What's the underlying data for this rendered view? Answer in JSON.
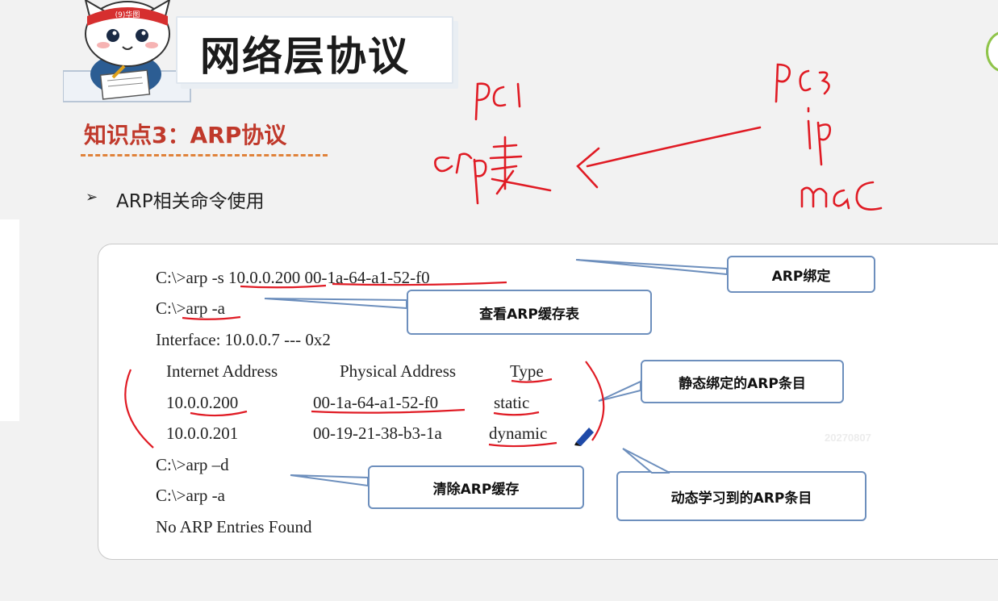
{
  "header": {
    "mascot_badge": "(9)华图",
    "title": "网络层协议",
    "subtitle": "知识点3：ARP协议",
    "bullet_glyph": "➢",
    "bullet_text": "ARP相关命令使用"
  },
  "handwriting": {
    "pc1": "PC1",
    "arp_table": "arp表",
    "pc3": "PC3",
    "ip": "ip",
    "mac": "mac"
  },
  "code_lines": {
    "l1": "C:\\>arp -s 10.0.0.200 00-1a-64-a1-52-f0",
    "l2": "C:\\>arp -a",
    "l3": "Interface: 10.0.0.7 --- 0x2",
    "h_ip": "Internet Address",
    "h_mac": "Physical Address",
    "h_type": "Type",
    "r1_ip": "10.0.0.200",
    "r1_mac": "00-1a-64-a1-52-f0",
    "r1_type": "static",
    "r2_ip": "10.0.0.201",
    "r2_mac": "00-19-21-38-b3-1a",
    "r2_type": "dynamic",
    "l7": "C:\\>arp –d",
    "l8": "C:\\>arp -a",
    "l9": "No ARP Entries Found"
  },
  "callouts": {
    "bind": "ARP绑定",
    "view_cache": "查看ARP缓存表",
    "static_entry": "静态绑定的ARP条目",
    "clear_cache": "清除ARP缓存",
    "dynamic_entry": "动态学习到的ARP条目"
  },
  "watermark": "20270807",
  "colors": {
    "accent_red": "#c0392b",
    "ink_red": "#e01b24",
    "callout_border": "#6d8fbd",
    "pen_icon": "#1f4aa8"
  },
  "icons": [
    "mascot-cat-icon",
    "pen-cursor-icon"
  ]
}
